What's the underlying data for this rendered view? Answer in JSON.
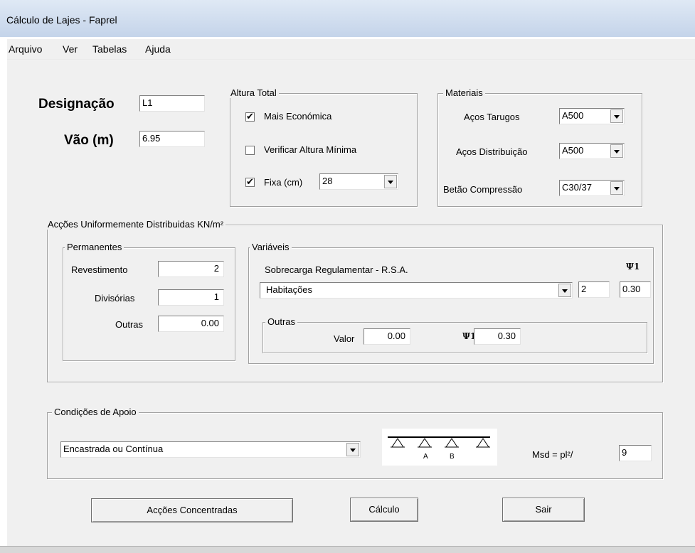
{
  "window": {
    "title": "Cálculo de Lajes - Faprel"
  },
  "menu": [
    "Arquivo",
    "Ver",
    "Tabelas",
    "Ajuda"
  ],
  "designacao": {
    "label": "Designação",
    "value": "L1"
  },
  "vao": {
    "label": "Vão (m)",
    "value": "6.95"
  },
  "altura_total": {
    "legend": "Altura Total",
    "mais_economica": {
      "label": "Mais Económica",
      "checked": true
    },
    "verificar_altura": {
      "label": "Verificar Altura Mínima",
      "checked": false
    },
    "fixa": {
      "label": "Fixa (cm)",
      "checked": true,
      "value": "28"
    }
  },
  "materiais": {
    "legend": "Materiais",
    "acos_tarugos": {
      "label": "Aços Tarugos",
      "value": "A500"
    },
    "acos_distribuicao": {
      "label": "Aços Distribuição",
      "value": "A500"
    },
    "betao_compressao": {
      "label": "Betão Compressão",
      "value": "C30/37"
    }
  },
  "accoes": {
    "legend": "Acções Uniformemente Distribuidas KN/m²",
    "permanentes": {
      "legend": "Permanentes",
      "revestimento": {
        "label": "Revestimento",
        "value": "2"
      },
      "divisorias": {
        "label": "Divisórias",
        "value": "1"
      },
      "outras": {
        "label": "Outras",
        "value": "0.00"
      }
    },
    "variaveis": {
      "legend": "Variáveis",
      "sobrecarga_label": "Sobrecarga Regulamentar - R.S.A.",
      "psi_label": "Ψ1",
      "tipo": "Habitações",
      "valor": "2",
      "psi": "0.30",
      "outras": {
        "legend": "Outras",
        "valor_label": "Valor",
        "valor": "0.00",
        "psi_label": "Ψ1",
        "psi": "0.30"
      }
    }
  },
  "apoio": {
    "legend": "Condições de Apoio",
    "tipo": "Encastrada ou Contínua",
    "diagram_labels": [
      "A",
      "B"
    ],
    "msd_label": "Msd =  pl²/",
    "msd_value": "9"
  },
  "buttons": {
    "accoes_concentradas": "Acções Concentradas",
    "calculo": "Cálculo",
    "sair": "Sair"
  }
}
